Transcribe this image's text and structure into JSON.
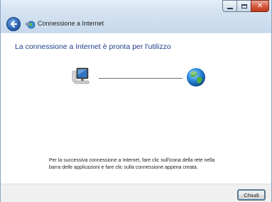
{
  "window": {
    "title": "Connessione a Internet",
    "controls": {
      "minimize": "minimize-icon",
      "maximize": "maximize-icon",
      "close": "close-icon"
    }
  },
  "main": {
    "heading": "La connessione a Internet è pronta per l'utilizzo",
    "instructions": "Per la successiva connessione a Internet, fare clic sull'icona della rete nella barra delle applicazioni e fare clic sulla connessione appena creata.",
    "icons": {
      "left": "computer-icon",
      "right": "globe-icon"
    }
  },
  "footer": {
    "close_label": "Chiudi"
  },
  "colors": {
    "heading": "#1e3d8f",
    "titlebar": "#d3e2f1",
    "footer": "#f0f0f0"
  }
}
